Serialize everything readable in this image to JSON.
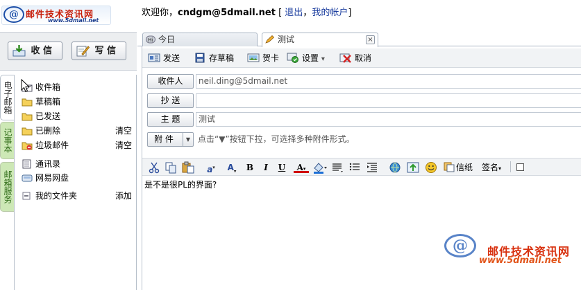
{
  "logo": {
    "at": "@",
    "name": "邮件技术资讯网",
    "url": "www.5dmail.net"
  },
  "welcome": {
    "greeting": "欢迎你，",
    "user": "cndgm@5dmail.net",
    "open": " [ ",
    "logout": "退出",
    "sep": "，",
    "account": "我的帐户",
    "close": "]"
  },
  "left": {
    "receive_label": "收 信",
    "write_label": "写 信",
    "vtabs": [
      "电子邮箱",
      "记事本",
      "邮箱服务"
    ],
    "folders": [
      {
        "label": "收件箱",
        "action": ""
      },
      {
        "label": "草稿箱",
        "action": ""
      },
      {
        "label": "已发送",
        "action": ""
      },
      {
        "label": "已删除",
        "action": "清空"
      },
      {
        "label": "垃圾邮件",
        "action": "清空"
      },
      {
        "label": "通讯录",
        "action": ""
      },
      {
        "label": "网易网盘",
        "action": ""
      },
      {
        "label": "我的文件夹",
        "action": "添加"
      }
    ]
  },
  "tabs": {
    "today": "今日",
    "compose": "测试",
    "close": "×"
  },
  "toolbar": {
    "send": "发送",
    "draft": "存草稿",
    "card": "贺卡",
    "settings": "设置",
    "settings_arrow": "▾",
    "cancel": "取消"
  },
  "fields": {
    "to_label": "收件人",
    "to_value": "neil.ding@5dmail.net",
    "cc_label": "抄 送",
    "cc_value": "",
    "subject_label": "主 题",
    "subject_value": "测试",
    "attach_label": "附 件",
    "attach_arrow": "▼",
    "attach_hint": "点击“▼”按钮下拉，可选择多种附件形式。"
  },
  "editor": {
    "stationery": "信纸",
    "signature": "签名",
    "signature_arrow": "▾",
    "body": "是不是很PL的界面?"
  },
  "watermark": {
    "at": "@",
    "name": "邮件技术资讯网",
    "url": "www.5dmail.net"
  },
  "colors": {
    "link": "#1a3c9e",
    "tab_green": "#cde8b6",
    "toolbar_bg": "#f1f3f5"
  }
}
